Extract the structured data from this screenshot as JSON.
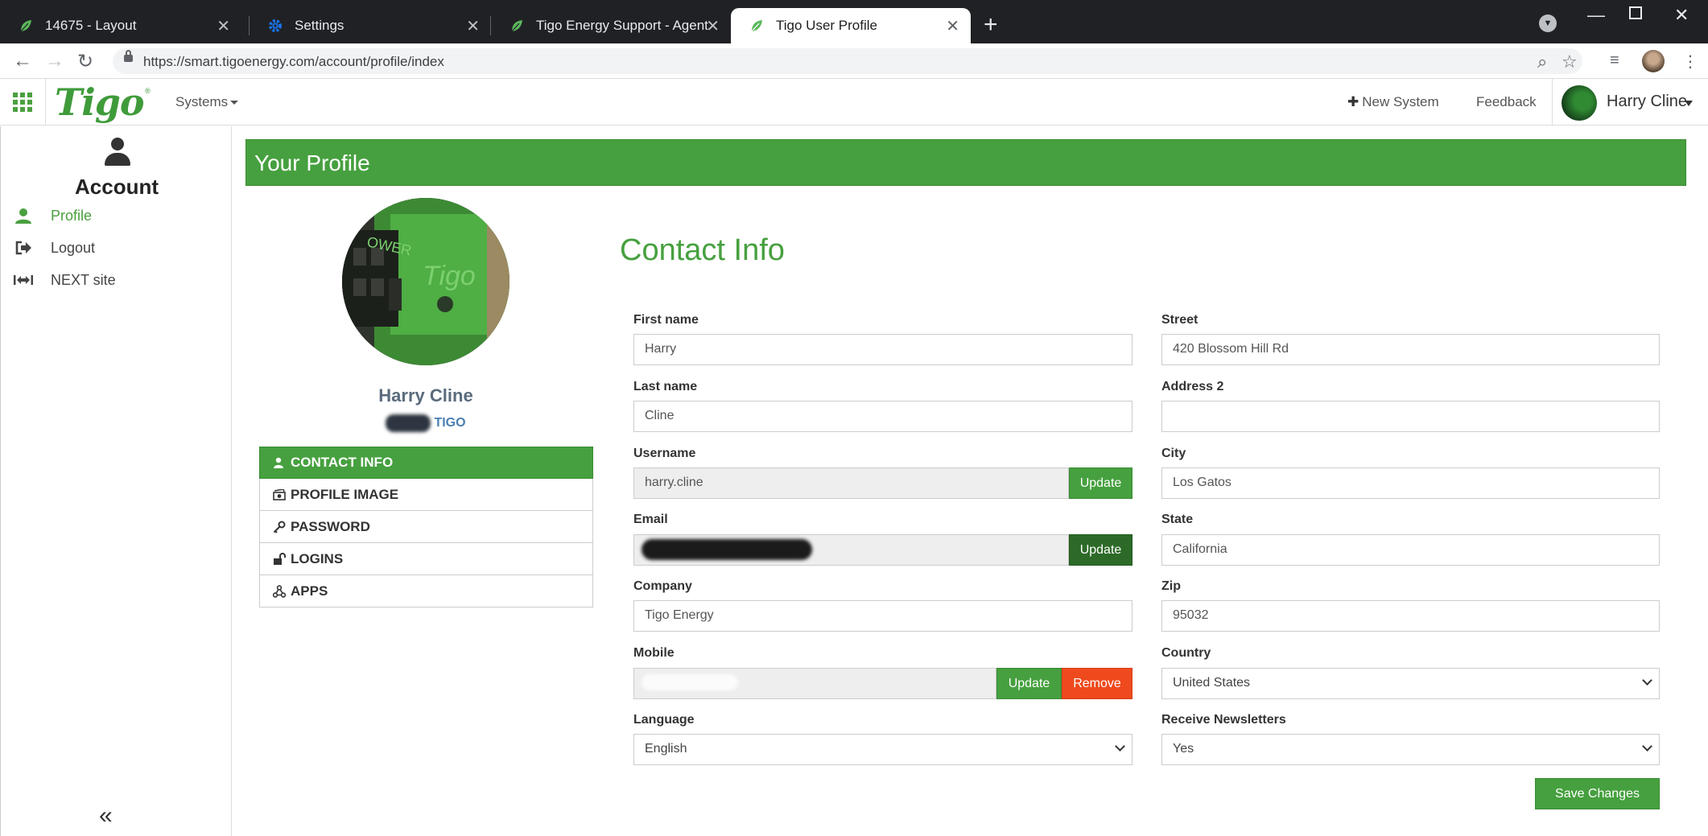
{
  "browser": {
    "tabs": [
      {
        "title": "14675 - Layout"
      },
      {
        "title": "Settings"
      },
      {
        "title": "Tigo Energy Support - Agent"
      },
      {
        "title": "Tigo User Profile"
      }
    ],
    "url": "https://smart.tigoenergy.com/account/profile/index"
  },
  "header": {
    "logo": "Tigo",
    "logo_mark": "®",
    "systems_label": "Systems",
    "new_system_label": "New System",
    "feedback_label": "Feedback",
    "user_name": "Harry Cline"
  },
  "sidebar": {
    "title": "Account",
    "items": [
      {
        "label": "Profile"
      },
      {
        "label": "Logout"
      },
      {
        "label": "NEXT site"
      }
    ],
    "collapse_label": "«"
  },
  "page": {
    "banner_title": "Your Profile",
    "profile_name": "Harry Cline",
    "profile_company": "TIGO",
    "profile_nav": [
      {
        "label": "CONTACT INFO"
      },
      {
        "label": "PROFILE IMAGE"
      },
      {
        "label": "PASSWORD"
      },
      {
        "label": "LOGINS"
      },
      {
        "label": "APPS"
      }
    ]
  },
  "contact": {
    "title": "Contact Info",
    "first_name": {
      "label": "First name",
      "value": "Harry"
    },
    "last_name": {
      "label": "Last name",
      "value": "Cline"
    },
    "username": {
      "label": "Username",
      "value": "harry.cline",
      "button": "Update"
    },
    "email": {
      "label": "Email",
      "button": "Update"
    },
    "company": {
      "label": "Company",
      "value": "Tigo Energy"
    },
    "mobile": {
      "label": "Mobile",
      "update": "Update",
      "remove": "Remove"
    },
    "language": {
      "label": "Language",
      "value": "English"
    },
    "street": {
      "label": "Street",
      "value": "420 Blossom Hill Rd"
    },
    "address2": {
      "label": "Address 2",
      "value": ""
    },
    "city": {
      "label": "City",
      "value": "Los Gatos"
    },
    "state": {
      "label": "State",
      "value": "California"
    },
    "zip": {
      "label": "Zip",
      "value": "95032"
    },
    "country": {
      "label": "Country",
      "value": "United States"
    },
    "newsletters": {
      "label": "Receive Newsletters",
      "value": "Yes"
    },
    "save_label": "Save Changes"
  }
}
